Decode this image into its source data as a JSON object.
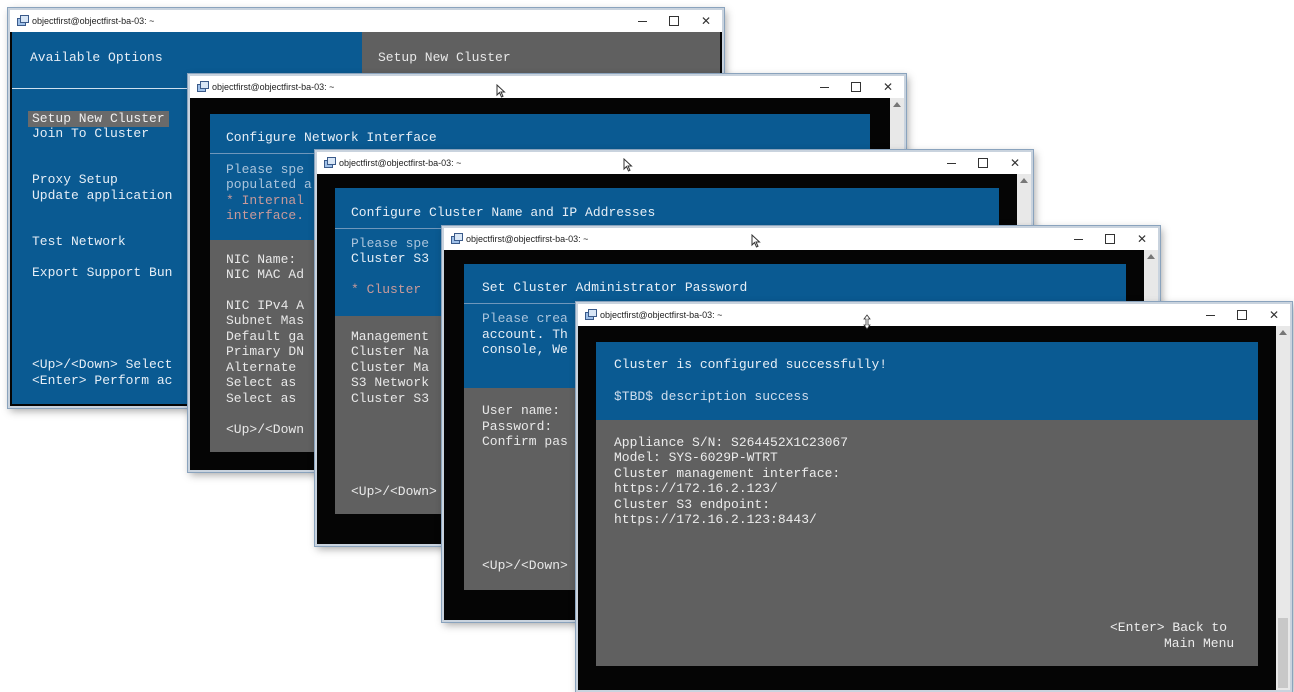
{
  "windows": {
    "w1": {
      "title": "objectfirst@objectfirst-ba-03: ~",
      "left_heading": "Available Options",
      "right_heading": "Setup New Cluster",
      "menu": [
        "Setup New Cluster",
        "Join To Cluster",
        "",
        "",
        "Proxy Setup",
        "Update application",
        "",
        "",
        "Test Network",
        "",
        "Export Support Bun"
      ],
      "hints": [
        "<Up>/<Down> Select",
        "<Enter> Perform ac"
      ]
    },
    "w2": {
      "title": "objectfirst@objectfirst-ba-03: ~",
      "heading": "Configure Network Interface",
      "desc": [
        "Please spe",
        "populated a",
        "* Internal",
        "interface."
      ],
      "fields": [
        "NIC Name:",
        "NIC MAC Ad",
        "",
        "NIC IPv4 A",
        "Subnet Mas",
        "Default ga",
        "Primary DN",
        "Alternate",
        "Select as",
        "Select as"
      ],
      "hint": "<Up>/<Down"
    },
    "w3": {
      "title": "objectfirst@objectfirst-ba-03: ~",
      "heading": "Configure Cluster Name and IP Addresses",
      "desc": [
        "Please spe",
        "Cluster S3",
        "",
        "* Cluster"
      ],
      "fields": [
        "Management",
        "Cluster Na",
        "Cluster Ma",
        "S3 Network",
        "Cluster S3"
      ],
      "hint": "<Up>/<Down>"
    },
    "w4": {
      "title": "objectfirst@objectfirst-ba-03: ~",
      "heading": "Set Cluster Administrator Password",
      "desc": [
        "Please crea",
        "account. Th",
        "console, We"
      ],
      "fields": [
        "User name:",
        "Password:",
        "Confirm pas"
      ],
      "hint": "<Up>/<Down>"
    },
    "w5": {
      "title": "objectfirst@objectfirst-ba-03: ~",
      "heading": "Cluster is configured successfully!",
      "subheading": "$TBD$ description success",
      "lines": [
        "Appliance S/N: S264452X1C23067",
        "Model: SYS-6029P-WTRT",
        "Cluster management interface:",
        "https://172.16.2.123/",
        "Cluster S3 endpoint:",
        "https://172.16.2.123:8443/"
      ],
      "footer": [
        "<Enter> Back to",
        "Main Menu"
      ]
    }
  },
  "controls": {
    "minimize": "–",
    "maximize": "",
    "close": "✕"
  },
  "colors": {
    "blue": "#0a5a92",
    "gray": "#606060",
    "black": "#050505"
  }
}
